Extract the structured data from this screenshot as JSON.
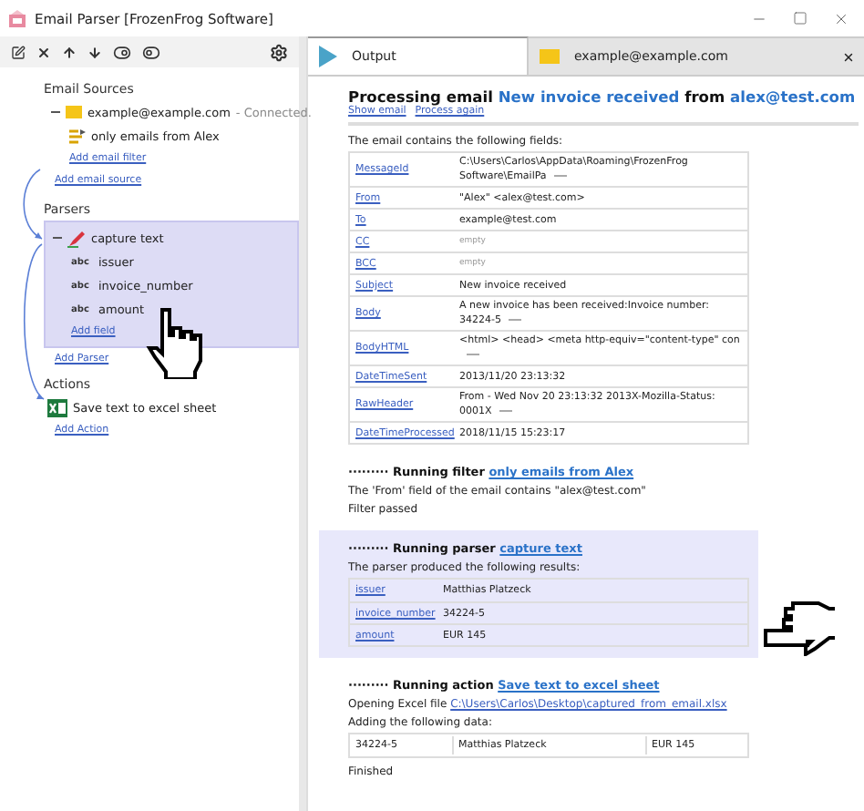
{
  "window": {
    "title": "Email Parser [FrozenFrog Software]"
  },
  "sources": {
    "heading": "Email Sources",
    "items": [
      {
        "name": "example@example.com",
        "status": "- Connected.",
        "expanded": true,
        "filters": [
          "only emails from Alex"
        ],
        "add_filter": "Add email filter"
      }
    ],
    "add_link": "Add email source"
  },
  "parsers": {
    "heading": "Parsers",
    "items": [
      {
        "name": "capture text",
        "expanded": true,
        "selected": true,
        "fields": [
          {
            "type_label": "abc",
            "name": "issuer"
          },
          {
            "type_label": "abc",
            "name": "invoice_number"
          },
          {
            "type_label": "abc",
            "name": "amount"
          }
        ],
        "add_field": "Add field"
      }
    ],
    "add_link": "Add Parser"
  },
  "actions": {
    "heading": "Actions",
    "items": [
      {
        "name": "Save text to excel sheet"
      }
    ],
    "add_link": "Add Action"
  },
  "tabs": [
    {
      "label": "Output",
      "kind": "output",
      "selected": true,
      "closable": false
    },
    {
      "label": "example@example.com",
      "kind": "mailbox",
      "selected": false,
      "closable": true
    }
  ],
  "output": {
    "heading": {
      "prefix": "Processing email",
      "subject": "New invoice received",
      "middle": "from",
      "sender": "alex@test.com"
    },
    "links": [
      "Show email",
      "Process again"
    ],
    "intro": "The email contains the following fields:",
    "fields": [
      {
        "name": "MessageId",
        "value": "C:\\Users\\Carlos\\AppData\\Roaming\\FrozenFrog Software\\EmailPa",
        "empty": false,
        "truncated": true
      },
      {
        "name": "From",
        "value": "\"Alex\" <alex@test.com>",
        "empty": false,
        "truncated": false
      },
      {
        "name": "To",
        "value": "example@test.com",
        "empty": false,
        "truncated": false
      },
      {
        "name": "CC",
        "value": "empty",
        "empty": true,
        "truncated": false
      },
      {
        "name": "BCC",
        "value": "empty",
        "empty": true,
        "truncated": false
      },
      {
        "name": "Subject",
        "value": "New invoice received",
        "empty": false,
        "truncated": false
      },
      {
        "name": "Body",
        "value": "A new invoice has been received:Invoice number: 34224-5",
        "empty": false,
        "truncated": true
      },
      {
        "name": "BodyHTML",
        "value": "<html> <head> <meta http-equiv=\"content-type\" con",
        "empty": false,
        "truncated": true
      },
      {
        "name": "DateTimeSent",
        "value": "2013/11/20 23:13:32",
        "empty": false,
        "truncated": false
      },
      {
        "name": "RawHeader",
        "value": "From - Wed Nov 20 23:13:32 2013X-Mozilla-Status: 0001X",
        "empty": false,
        "truncated": true
      },
      {
        "name": "DateTimeProcessed",
        "value": "2018/11/15 15:23:17",
        "empty": false,
        "truncated": false
      }
    ],
    "filter": {
      "marker": "·········",
      "label": "Running filter",
      "link": "only emails from Alex",
      "lines": [
        "The 'From' field of the email contains \"alex@test.com\"",
        "Filter passed"
      ]
    },
    "parser": {
      "marker": "·········",
      "label": "Running parser",
      "link": "capture text",
      "highlighted": true,
      "intro": "The parser produced the following results:",
      "results": [
        {
          "name": "issuer",
          "value": "Matthias Platzeck"
        },
        {
          "name": "invoice_number",
          "value": "34224-5"
        },
        {
          "name": "amount",
          "value": "EUR 145"
        }
      ]
    },
    "action": {
      "marker": "·········",
      "label": "Running action",
      "link": "Save text to excel sheet",
      "file_prefix": "Opening Excel file",
      "file_link": "C:\\Users\\Carlos\\Desktop\\captured_from_email.xlsx",
      "adding": "Adding the following data:",
      "data_row": [
        "34224-5",
        "Matthias Platzeck",
        "EUR 145"
      ],
      "finished": "Finished"
    }
  }
}
